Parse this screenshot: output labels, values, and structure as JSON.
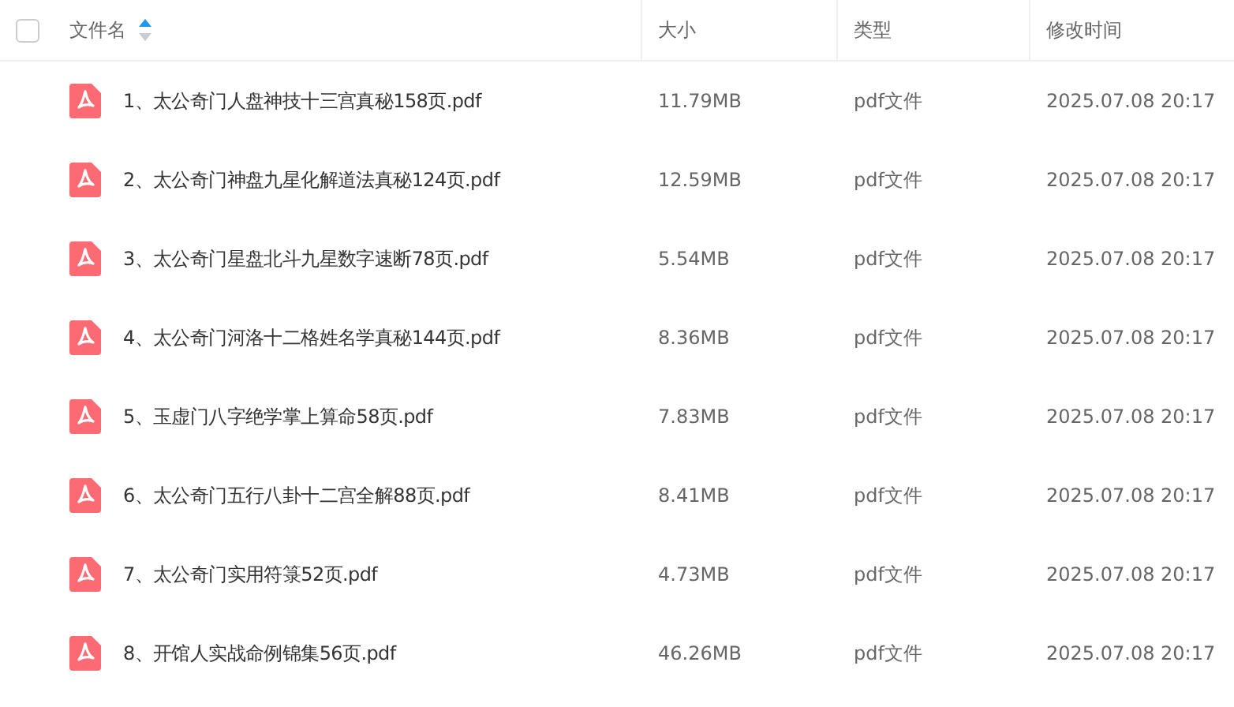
{
  "header": {
    "select_all": {
      "checked": false
    },
    "columns": [
      {
        "label": "文件名",
        "sorted_ascending": true
      },
      {
        "label": "大小"
      },
      {
        "label": "类型"
      },
      {
        "label": "修改时间"
      }
    ]
  },
  "files": [
    {
      "name": "1、太公奇门人盘神技十三宫真秘158页.pdf",
      "size": "11.79MB",
      "type": "pdf文件",
      "modified": "2025.07.08 20:17"
    },
    {
      "name": "2、太公奇门神盘九星化解道法真秘124页.pdf",
      "size": "12.59MB",
      "type": "pdf文件",
      "modified": "2025.07.08 20:17"
    },
    {
      "name": "3、太公奇门星盘北斗九星数字速断78页.pdf",
      "size": "5.54MB",
      "type": "pdf文件",
      "modified": "2025.07.08 20:17"
    },
    {
      "name": "4、太公奇门河洛十二格姓名学真秘144页.pdf",
      "size": "8.36MB",
      "type": "pdf文件",
      "modified": "2025.07.08 20:17"
    },
    {
      "name": "5、玉虚门八字绝学掌上算命58页.pdf",
      "size": "7.83MB",
      "type": "pdf文件",
      "modified": "2025.07.08 20:17"
    },
    {
      "name": "6、太公奇门五行八卦十二宫全解88页.pdf",
      "size": "8.41MB",
      "type": "pdf文件",
      "modified": "2025.07.08 20:17"
    },
    {
      "name": "7、太公奇门实用符箓52页.pdf",
      "size": "4.73MB",
      "type": "pdf文件",
      "modified": "2025.07.08 20:17"
    },
    {
      "name": "8、开馆人实战命例锦集56页.pdf",
      "size": "46.26MB",
      "type": "pdf文件",
      "modified": "2025.07.08 20:17"
    }
  ]
}
